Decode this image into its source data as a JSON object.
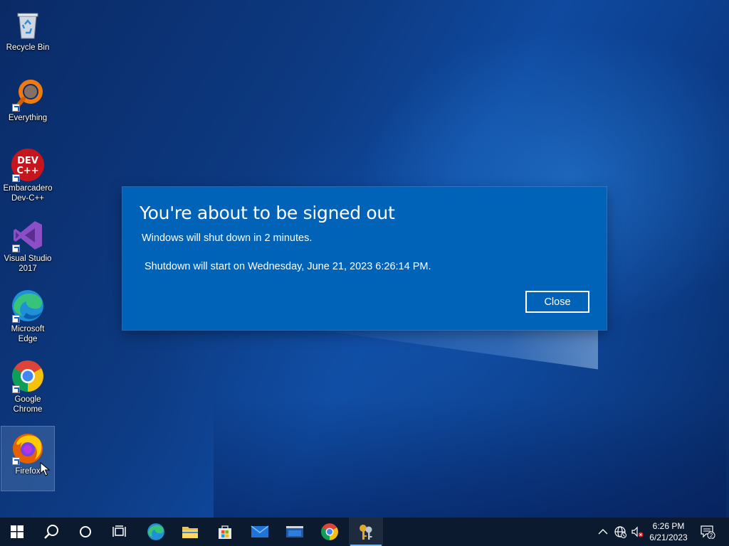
{
  "desktop": {
    "icons": [
      {
        "label": "Recycle Bin",
        "icon": "recycle-bin-icon"
      },
      {
        "label": "Everything",
        "icon": "everything-search-icon"
      },
      {
        "label": "Embarcadero Dev-C++",
        "icon": "dev-cpp-icon",
        "glyph_text": "DEV C++"
      },
      {
        "label": "Visual Studio 2017",
        "icon": "visual-studio-icon"
      },
      {
        "label": "Microsoft Edge",
        "icon": "edge-icon"
      },
      {
        "label": "Google Chrome",
        "icon": "chrome-icon"
      },
      {
        "label": "Firefox",
        "icon": "firefox-icon",
        "selected": true
      }
    ]
  },
  "dialog": {
    "title": "You're about to be signed out",
    "message": "Windows will shut down in 2 minutes.",
    "detail": "Shutdown will start on Wednesday, June 21, 2023 6:26:14 PM.",
    "close_label": "Close",
    "bg_color": "#0063b8"
  },
  "taskbar": {
    "items": [
      {
        "name": "start",
        "icon": "windows-logo-icon"
      },
      {
        "name": "search",
        "icon": "search-icon"
      },
      {
        "name": "cortana",
        "icon": "cortana-circle-icon"
      },
      {
        "name": "task-view",
        "icon": "task-view-icon"
      },
      {
        "name": "edge",
        "icon": "edge-icon"
      },
      {
        "name": "file-explorer",
        "icon": "folder-icon"
      },
      {
        "name": "store",
        "icon": "store-bag-icon"
      },
      {
        "name": "mail",
        "icon": "mail-icon"
      },
      {
        "name": "movies",
        "icon": "film-icon"
      },
      {
        "name": "chrome",
        "icon": "chrome-icon"
      },
      {
        "name": "app",
        "icon": "keys-app-icon",
        "active": true
      }
    ],
    "tray": {
      "icons": [
        "chevron-up-icon",
        "network-globe-icon",
        "volume-muted-icon"
      ],
      "time": "6:26 PM",
      "date": "6/21/2023",
      "notification_count": "2"
    },
    "bg_color": "#0b1a2e"
  }
}
